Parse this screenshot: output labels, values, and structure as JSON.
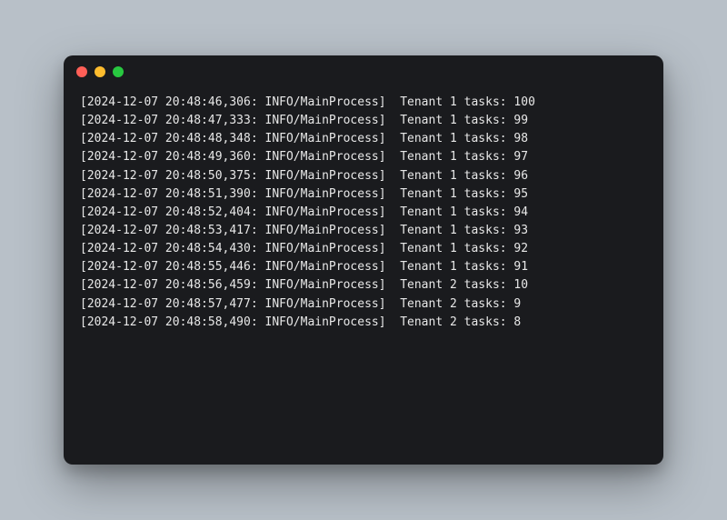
{
  "window": {
    "traffic_lights": [
      "close",
      "minimize",
      "maximize"
    ]
  },
  "log": {
    "level": "INFO",
    "process": "MainProcess",
    "lines": [
      {
        "ts": "2024-12-07 20:48:46,306",
        "msg": "Tenant 1 tasks: 100"
      },
      {
        "ts": "2024-12-07 20:48:47,333",
        "msg": "Tenant 1 tasks: 99"
      },
      {
        "ts": "2024-12-07 20:48:48,348",
        "msg": "Tenant 1 tasks: 98"
      },
      {
        "ts": "2024-12-07 20:48:49,360",
        "msg": "Tenant 1 tasks: 97"
      },
      {
        "ts": "2024-12-07 20:48:50,375",
        "msg": "Tenant 1 tasks: 96"
      },
      {
        "ts": "2024-12-07 20:48:51,390",
        "msg": "Tenant 1 tasks: 95"
      },
      {
        "ts": "2024-12-07 20:48:52,404",
        "msg": "Tenant 1 tasks: 94"
      },
      {
        "ts": "2024-12-07 20:48:53,417",
        "msg": "Tenant 1 tasks: 93"
      },
      {
        "ts": "2024-12-07 20:48:54,430",
        "msg": "Tenant 1 tasks: 92"
      },
      {
        "ts": "2024-12-07 20:48:55,446",
        "msg": "Tenant 1 tasks: 91"
      },
      {
        "ts": "2024-12-07 20:48:56,459",
        "msg": "Tenant 2 tasks: 10"
      },
      {
        "ts": "2024-12-07 20:48:57,477",
        "msg": "Tenant 2 tasks: 9"
      },
      {
        "ts": "2024-12-07 20:48:58,490",
        "msg": "Tenant 2 tasks: 8"
      }
    ]
  }
}
